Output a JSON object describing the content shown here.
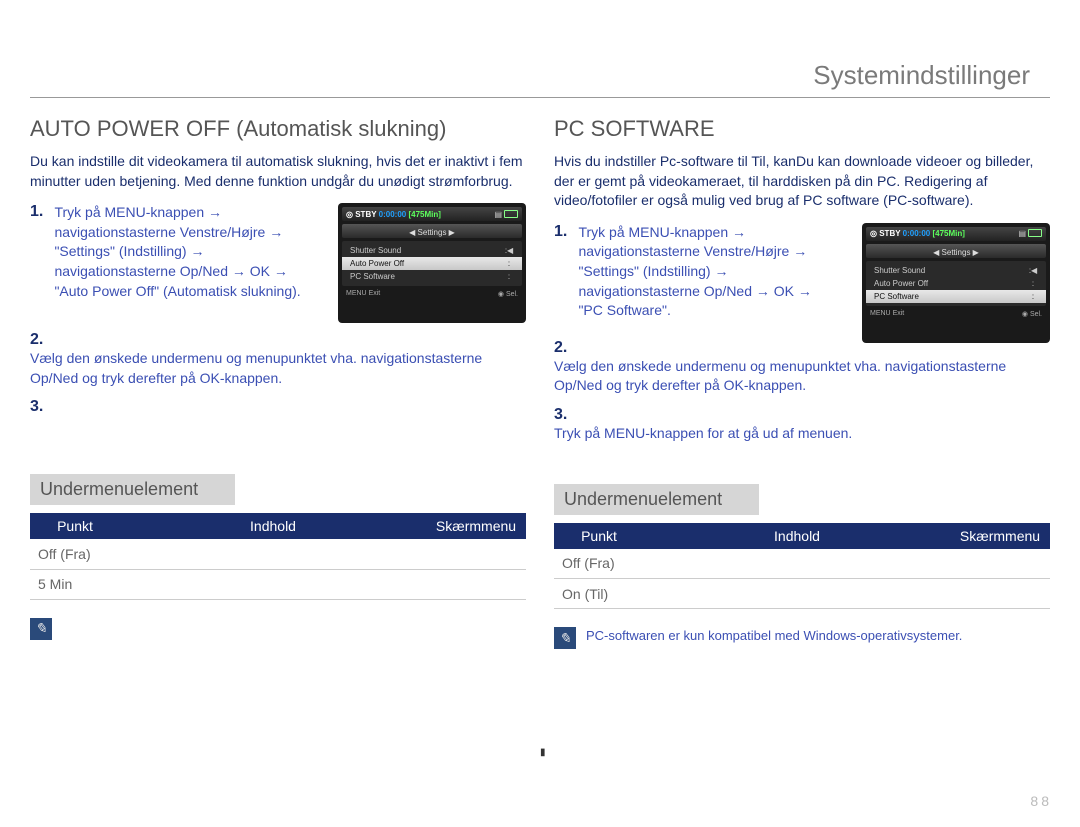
{
  "pageTitle": "Systemindstillinger",
  "pageNumber": "88",
  "left": {
    "heading": "AUTO POWER OFF (Automatisk slukning)",
    "intro": "Du kan indstille dit videokamera til automatisk slukning, hvis det er inaktivt i fem minutter uden betjening. Med denne funktion undgår du unødigt strømforbrug.",
    "step1_num": "1.",
    "step1_text": "Tryk på MENU-knappen → navigationstasterne Venstre/Højre → \"Settings\" (Indstilling) → navigationstasterne Op/Ned → OK → \"Auto Power Off\" (Automatisk slukning).",
    "step2_num": "2.",
    "step2_text": "Vælg den ønskede undermenu og menupunktet vha. navigationstasterne Op/Ned og tryk derefter på OK-knappen.",
    "step3_num": "3.",
    "step3_text": "",
    "screenshot": {
      "stby": "STBY",
      "time": "0:00:00",
      "remain": "[475Min]",
      "settingsTab": "Settings",
      "items": [
        "Shutter Sound",
        "Auto Power Off",
        "PC Software"
      ],
      "selectedIdx": 1,
      "menuLabel": "MENU",
      "exitLabel": "Exit",
      "selLabel": "Sel."
    },
    "submenuTitle": "Undermenuelement",
    "table": {
      "headers": [
        "Punkt",
        "Indhold",
        "Skærmmenu"
      ],
      "rows": [
        {
          "c1": "Off (Fra)",
          "c2": "",
          "c3": ""
        },
        {
          "c1": "5 Min",
          "c2": "",
          "c3": ""
        }
      ]
    }
  },
  "right": {
    "heading": "PC SOFTWARE",
    "intro": "Hvis du indstiller Pc-software til Til, kanDu kan downloade videoer og billeder, der er gemt på videokameraet, til harddisken på din PC. Redigering af video/fotofiler er også mulig ved brug af PC software (PC-software).",
    "step1_num": "1.",
    "step1_text": "Tryk på MENU-knappen → navigationstasterne Venstre/Højre → \"Settings\" (Indstilling) → navigationstasterne Op/Ned → OK → \"PC Software\".",
    "step2_num": "2.",
    "step2_text": "Vælg den ønskede undermenu og menupunktet vha. navigationstasterne Op/Ned og tryk derefter på OK-knappen.",
    "step3_num": "3.",
    "step3_text": "Tryk på MENU-knappen for at gå ud af menuen.",
    "screenshot": {
      "stby": "STBY",
      "time": "0:00:00",
      "remain": "[475Min]",
      "settingsTab": "Settings",
      "items": [
        "Shutter Sound",
        "Auto Power Off",
        "PC Software"
      ],
      "selectedIdx": 2,
      "menuLabel": "MENU",
      "exitLabel": "Exit",
      "selLabel": "Sel."
    },
    "submenuTitle": "Undermenuelement",
    "table": {
      "headers": [
        "Punkt",
        "Indhold",
        "Skærmmenu"
      ],
      "rows": [
        {
          "c1": "Off (Fra)",
          "c2": "",
          "c3": ""
        },
        {
          "c1": "On (Til)",
          "c2": "",
          "c3": ""
        }
      ]
    },
    "noteText": "PC-softwaren er kun kompatibel med Windows-operativsystemer."
  }
}
